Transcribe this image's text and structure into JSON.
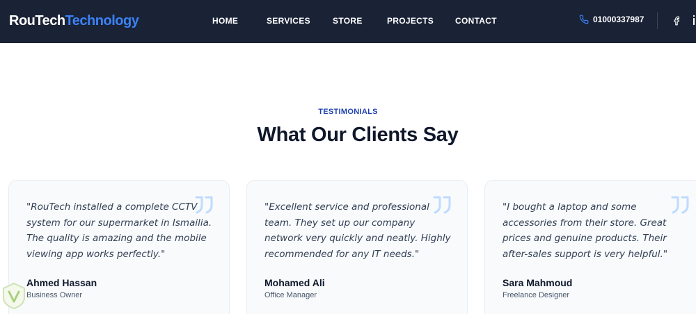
{
  "brand": {
    "part1": "RouTech",
    "part2": "Technology"
  },
  "nav": [
    {
      "label": "HOME"
    },
    {
      "label": "SERVICES"
    },
    {
      "label": "STORE"
    },
    {
      "label": "PROJECTS"
    },
    {
      "label": "CONTACT"
    }
  ],
  "header": {
    "phone": "01000337987"
  },
  "section": {
    "label": "TESTIMONIALS",
    "title": "What Our Clients Say"
  },
  "testimonials": [
    {
      "text": "\"RouTech installed a complete CCTV system for our supermarket in Ismailia. The quality is amazing and the mobile viewing app works perfectly.\"",
      "name": "Ahmed Hassan",
      "role": "Business Owner"
    },
    {
      "text": "\"Excellent service and professional team. They set up our company network very quickly and neatly. Highly recommended for any IT needs.\"",
      "name": "Mohamed Ali",
      "role": "Office Manager"
    },
    {
      "text": "\"I bought a laptop and some accessories from their store. Great prices and genuine products. Their after-sales support is very helpful.\"",
      "name": "Sara Mahmoud",
      "role": "Freelance Designer"
    }
  ],
  "colors": {
    "header_bg": "#1a2236",
    "accent": "#3b82f6",
    "label": "#1e40af",
    "quote_icon": "#bfdbfe",
    "card_bg": "#f8fafc"
  },
  "icons": [
    "phone-icon",
    "facebook-icon",
    "quote-icon",
    "watermark-badge-icon"
  ]
}
